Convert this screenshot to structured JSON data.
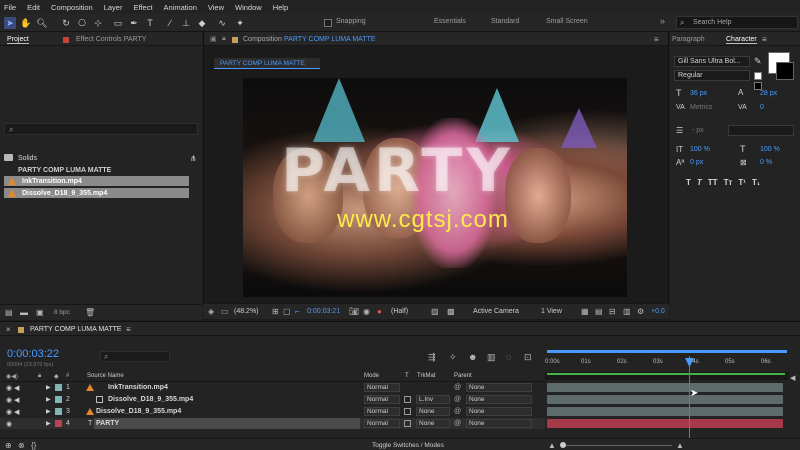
{
  "menu": [
    "File",
    "Edit",
    "Composition",
    "Layer",
    "Effect",
    "Animation",
    "View",
    "Window",
    "Help"
  ],
  "toolbar": {
    "snapping_label": "Snapping",
    "workspaces": [
      "Essentials",
      "Standard",
      "Small Screen"
    ],
    "search_placeholder": "Search Help"
  },
  "project_panel": {
    "tab_project": "Project",
    "tab_effect_controls": "Effect Controls PARTY",
    "items": [
      {
        "name": "Solids",
        "type": "folder"
      },
      {
        "name": "PARTY COMP LUMA MATTE",
        "type": "comp"
      },
      {
        "name": "InkTransition.mp4",
        "type": "footage",
        "selected": true
      },
      {
        "name": "Dissolve_D18_9_355.mp4",
        "type": "footage",
        "selected": true
      }
    ],
    "bpc": "8 bpc"
  },
  "composition": {
    "header": "Composition",
    "comp_name": "PARTY COMP LUMA MATTE",
    "comp_tab": "PARTY COMP LUMA MATTE",
    "overlay_text": "PARTY",
    "watermark": "www.cgtsj.com",
    "footer": {
      "zoom": "(48.2%)",
      "timecode": "0:00:03:21",
      "resolution": "(Half)",
      "camera": "Active Camera",
      "views": "1 View",
      "exposure": "+0.0"
    }
  },
  "character_panel": {
    "tab_paragraph": "Paragraph",
    "tab_character": "Character",
    "font_family": "Gill Sans Ultra Bol...",
    "font_style": "Regular",
    "font_size": "36 px",
    "leading": "28 px",
    "kerning": "Metrics",
    "tracking": "0",
    "stroke_width": "- px",
    "vertical_scale": "100 %",
    "horizontal_scale": "100 %",
    "baseline_shift": "0 px",
    "tsume": "0 %",
    "style_buttons": [
      "T",
      "T",
      "TT",
      "Tт",
      "T¹",
      "T₁"
    ],
    "colors": {
      "fill": "#ffffff",
      "stroke": "#000000"
    }
  },
  "timeline": {
    "comp_tab": "PARTY COMP LUMA MATTE",
    "current_time": "0:00:03:22",
    "frame_info": "00094 (23.976 fps)",
    "columns": {
      "source_name": "Source Name",
      "mode": "Mode",
      "t": "T",
      "trkmat": "TrkMat",
      "parent": "Parent"
    },
    "ruler": [
      "0:00s",
      "01s",
      "02s",
      "03s",
      "04s",
      "05s",
      "06s"
    ],
    "layers": [
      {
        "num": "1",
        "name": "InkTransition.mp4",
        "mode": "Normal",
        "trkmat": "",
        "parent": "None",
        "color": "#7fb5b5"
      },
      {
        "num": "2",
        "name": "Dissolve_D18_9_355.mp4",
        "mode": "Normal",
        "trkmat": "L.Inv",
        "parent": "None",
        "color": "#7fb5b5"
      },
      {
        "num": "3",
        "name": "Dissolve_D18_9_355.mp4",
        "mode": "Normal",
        "trkmat": "None",
        "parent": "None",
        "color": "#7fb5b5"
      },
      {
        "num": "4",
        "name": "PARTY",
        "mode": "Normal",
        "trkmat": "None",
        "parent": "None",
        "color": "#c04050"
      }
    ],
    "footer_label": "Toggle Switches / Modes",
    "colors": {
      "accent": "#4a9bff",
      "work_area": "#47b347",
      "playhead": "#e04a4a"
    }
  }
}
